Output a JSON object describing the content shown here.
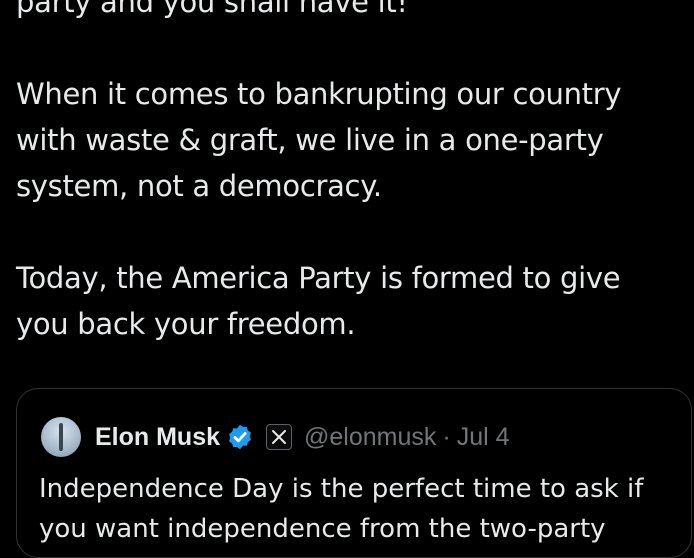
{
  "tweet": {
    "lines": [
      "party and you shall have it!",
      "When it comes to bankrupting our country",
      "with waste & graft, we live in a one-party",
      "system, not a democracy.",
      "Today, the America Party is formed to give",
      "you back your freedom."
    ]
  },
  "quoted_tweet": {
    "author_name": "Elon Musk",
    "handle": "@elonmusk",
    "separator": "·",
    "date": "Jul 4",
    "verified_icon": "verified-badge-icon",
    "affiliate_icon": "x-logo-icon",
    "lines": [
      "Independence Day is the perfect time to ask if",
      "you want independence from the two-party"
    ]
  },
  "colors": {
    "background": "#000000",
    "text": "#e7e9ea",
    "secondary": "#71767b",
    "verified": "#1d9bf0",
    "border": "#2f3336"
  }
}
